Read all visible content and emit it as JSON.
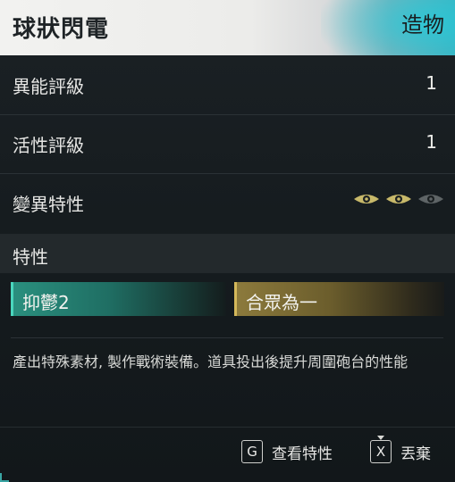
{
  "header": {
    "title": "球狀閃電",
    "category": "造物"
  },
  "stats": [
    {
      "label": "異能評級",
      "value": "1"
    },
    {
      "label": "活性評級",
      "value": "1"
    }
  ],
  "mutation": {
    "label": "變異特性",
    "level_filled": 2,
    "level_max": 3,
    "icon": "eye-icon",
    "filled_color": "#c8b96a",
    "empty_color": "#5e6466"
  },
  "traits": {
    "heading": "特性",
    "chips": [
      {
        "label": "抑鬱2",
        "color": "#2a8f7e"
      },
      {
        "label": "合眾為一",
        "color": "#8c7a3c"
      }
    ]
  },
  "description": "產出特殊素材, 製作戰術裝備。道具投出後提升周圍砲台的性能",
  "actions": [
    {
      "key": "G",
      "label": "查看特性"
    },
    {
      "key": "X",
      "label": "丟棄"
    }
  ]
}
